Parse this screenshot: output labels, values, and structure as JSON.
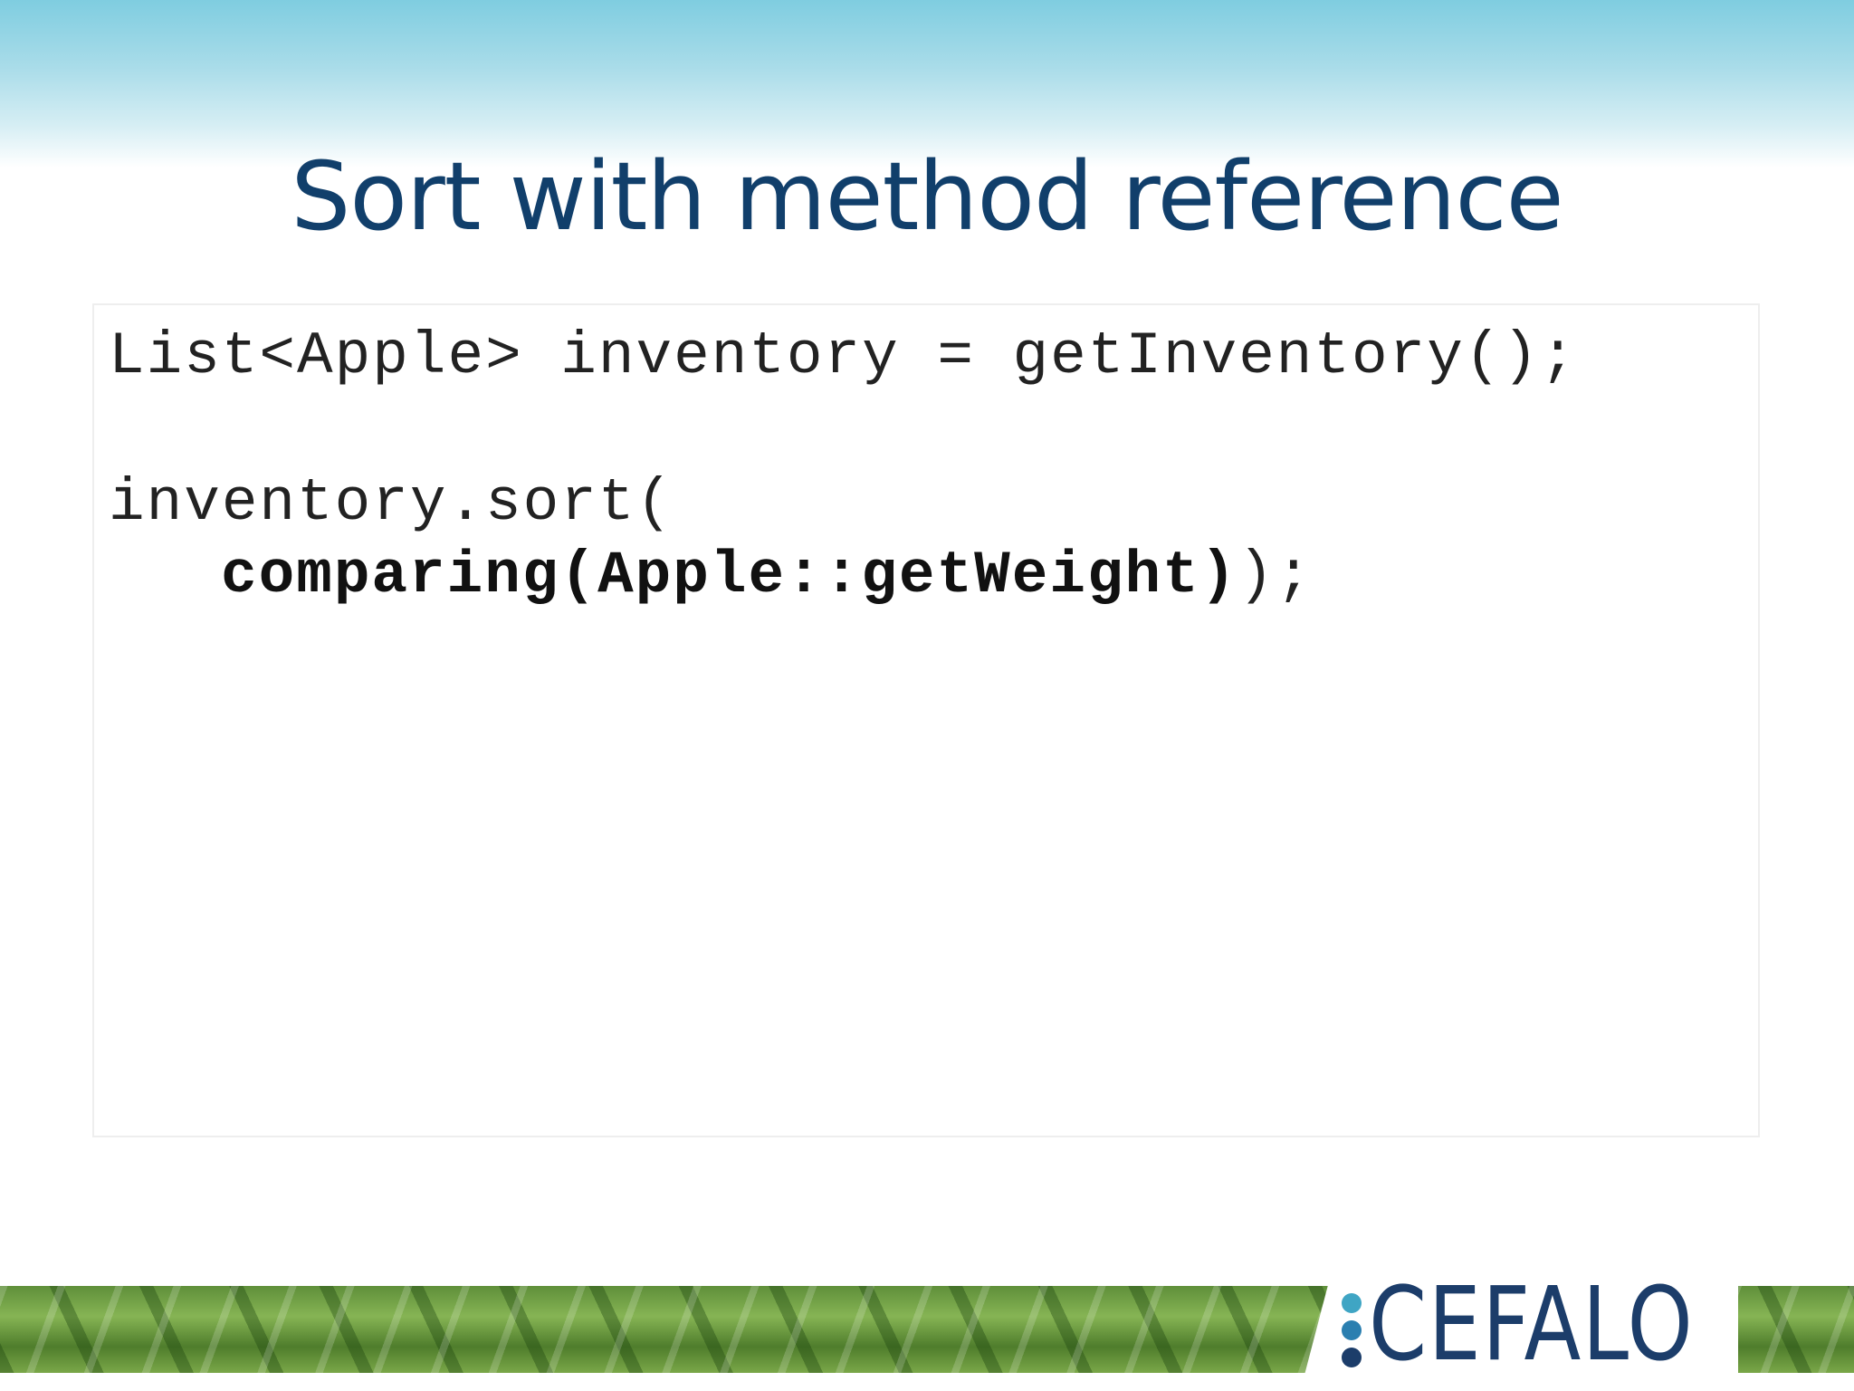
{
  "slide": {
    "title": "Sort with method reference"
  },
  "code": {
    "line1": "List<Apple> inventory = getInventory();",
    "line2": "inventory.sort(",
    "line3_bold": "comparing(Apple::getWeight)",
    "line3_rest": ");"
  },
  "logo": {
    "text": "CEFALO"
  },
  "colors": {
    "title": "#113f6b",
    "logo": "#1c3d6a"
  }
}
